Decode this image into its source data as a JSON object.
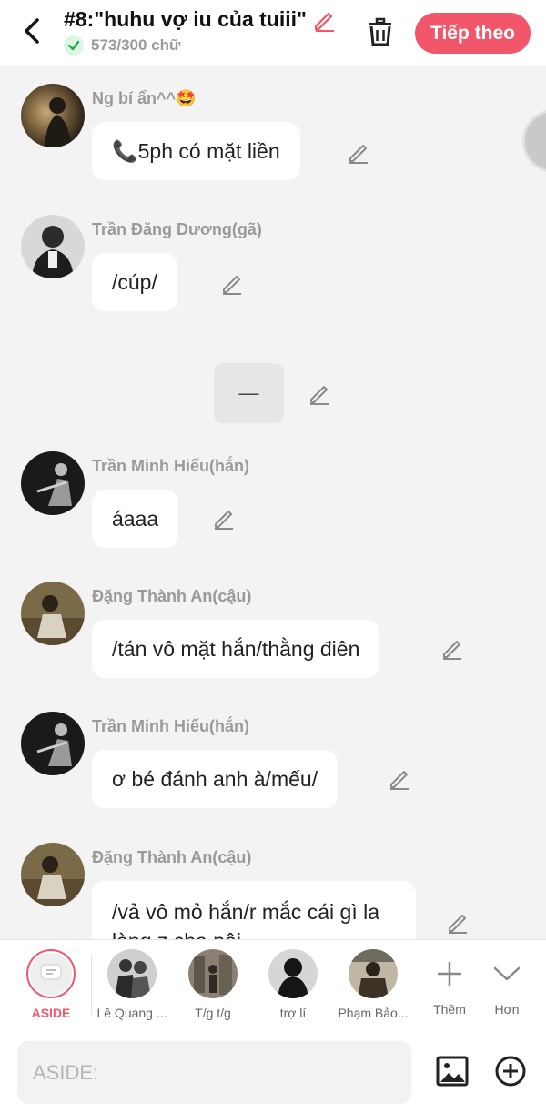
{
  "header": {
    "title": "#8:\"huhu vợ iu của tuiii\"",
    "word_count": "573/300 chữ",
    "next_label": "Tiếp theo"
  },
  "messages": [
    {
      "sender": "Ng bí ẩn^^🤩",
      "text": "📞5ph có mặt liền",
      "avatar": "avatar-mystery"
    },
    {
      "sender": "Trần Đăng Dương(gã)",
      "text": "/cúp/",
      "avatar": "avatar-duong"
    },
    {
      "divider": "—"
    },
    {
      "sender": "Trần Minh Hiếu(hắn)",
      "text": "áaaa",
      "avatar": "avatar-hieu"
    },
    {
      "sender": "Đặng Thành An(cậu)",
      "text": "/tán vô mặt hắn/thằng điên",
      "avatar": "avatar-an"
    },
    {
      "sender": "Trần Minh Hiếu(hắn)",
      "text": "ơ bé đánh anh à/mếu/",
      "avatar": "avatar-hieu"
    },
    {
      "sender": "Đặng Thành An(cậu)",
      "text": "/vả vô mỏ hắn/r mắc cái gì la làng z cha nội",
      "avatar": "avatar-an"
    }
  ],
  "character_bar": {
    "items": [
      {
        "label": "ASIDE"
      },
      {
        "label": "Lê Quang ..."
      },
      {
        "label": "T/g t/g"
      },
      {
        "label": "trợ lí"
      },
      {
        "label": "Phạm Bảo..."
      }
    ],
    "more_label": "Thêm",
    "expand_label": "Hơn"
  },
  "input": {
    "placeholder": "ASIDE:"
  },
  "colors": {
    "accent": "#f2566a",
    "background": "#f3f3f3",
    "bubble": "#ffffff",
    "muted_text": "#9a9a9a"
  }
}
